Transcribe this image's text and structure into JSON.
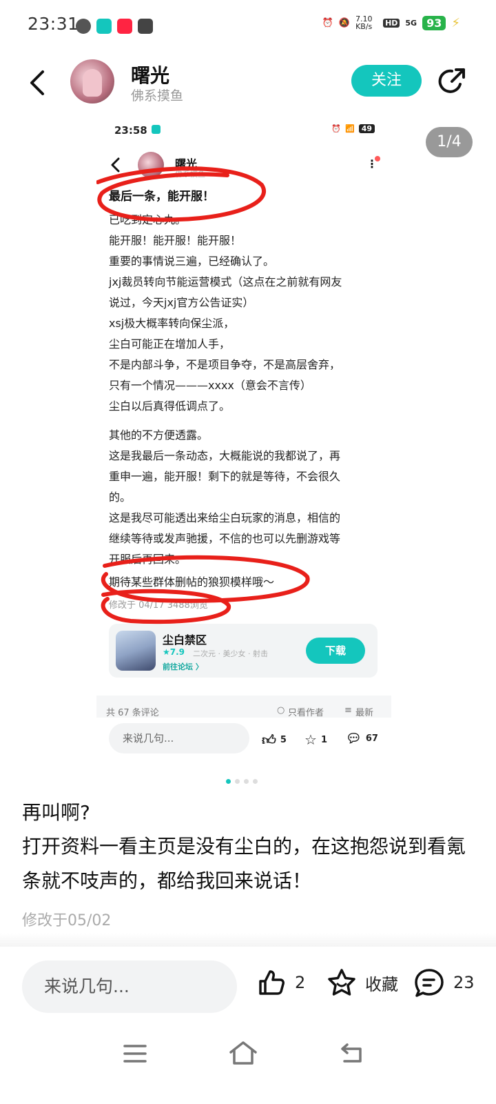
{
  "status_bar": {
    "time": "23:31",
    "net_speed": "7.10 KB/s",
    "hd": "HD",
    "signal": "5G",
    "battery": "93"
  },
  "header": {
    "author_name": "曙光",
    "author_subtitle": "佛系摸鱼",
    "follow_label": "关注"
  },
  "gallery": {
    "page_counter": "1/4",
    "dots": {
      "count": 4,
      "active_index": 0
    }
  },
  "embedded_screenshot": {
    "status_time": "23:58",
    "battery": "49",
    "author_name": "曙光",
    "author_subtitle": "佛系摸鱼",
    "post_title": "最后一条，能开服！",
    "paragraph_1": [
      "已吃到定心丸。",
      "能开服！能开服！能开服！",
      "重要的事情说三遍，已经确认了。",
      "jxj裁员转向节能运营模式（这点在之前就有网友",
      "说过，今天jxj官方公告证实）",
      "xsj极大概率转向保尘派，",
      "尘白可能正在增加人手，",
      "不是内部斗争，不是项目争夺，不是高层舍弃，",
      "只有一个情况———xxxx（意会不言传）",
      "尘白以后真得低调点了。"
    ],
    "paragraph_2": [
      "其他的不方便透露。",
      "这是我最后一条动态，大概能说的我都说了，再",
      "重申一遍，能开服！剩下的就是等待，不会很久",
      "的。",
      "这是我尽可能透出来给尘白玩家的消息，相信的",
      "继续等待或发声驰援，不信的也可以先删游戏等",
      "开服后再回来。"
    ],
    "last_line": "期待某些群体删帖的狼狈模样哦～",
    "meta": "修改于 04/17  3488浏览",
    "game": {
      "name": "尘白禁区",
      "rating": "★7.9",
      "tags": "二次元 · 美少女 · 射击",
      "forum_link": "前往论坛 〉",
      "download_label": "下载"
    },
    "comments_count": "共 67 条评论",
    "only_author": "只看作者",
    "newest": "最新",
    "input_placeholder": "来说几句...",
    "likes": "5",
    "favorites": "1",
    "comments": "67",
    "annotation_color": "#e8201a"
  },
  "post": {
    "title": "再叫啊?",
    "body": "打开资料一看主页是没有尘白的，在这抱怨说到看氪条就不吱声的，都给我回来说话！",
    "date": "修改于05/02"
  },
  "bottom_bar": {
    "input_placeholder": "来说几句...",
    "likes": "2",
    "favorite_label": "收藏",
    "comments": "23"
  },
  "colors": {
    "accent": "#14c6bd",
    "text_primary": "#111111",
    "text_secondary": "#999999",
    "annotation_red": "#e8201a"
  }
}
